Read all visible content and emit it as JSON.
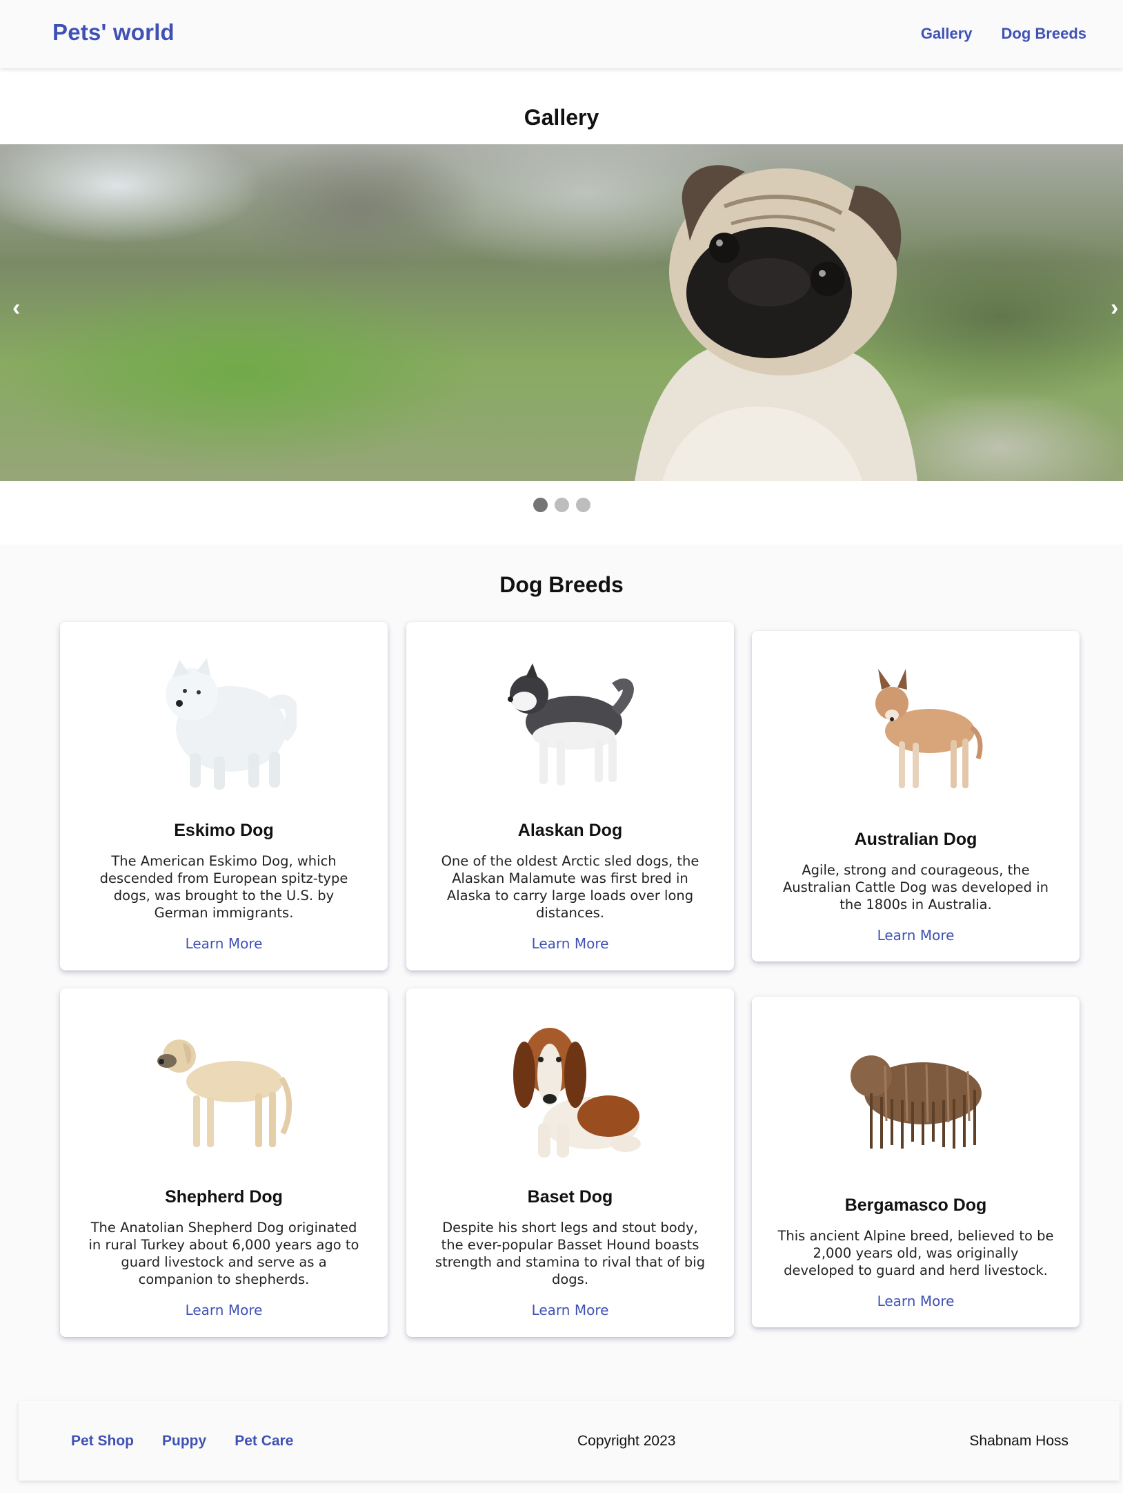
{
  "header": {
    "brand": "Pets' world",
    "nav": [
      "Gallery",
      "Dog Breeds"
    ]
  },
  "gallery": {
    "title": "Gallery",
    "prev_arrow": "‹",
    "next_arrow": "›",
    "slide_count": 3,
    "active_slide": 1
  },
  "breeds": {
    "title": "Dog Breeds",
    "cards": [
      {
        "name": "Eskimo Dog",
        "text": "The American Eskimo Dog, which descended from European spitz-type dogs, was brought to the U.S. by German immigrants.",
        "link": "Learn More"
      },
      {
        "name": "Alaskan Dog",
        "text": "One of the oldest Arctic sled dogs, the Alaskan Malamute was first bred in Alaska to carry large loads over long distances.",
        "link": "Learn More"
      },
      {
        "name": "Australian Dog",
        "text": "Agile, strong and courageous, the Australian Cattle Dog was developed in the 1800s in Australia.",
        "link": "Learn More"
      },
      {
        "name": "Shepherd Dog",
        "text": "The Anatolian Shepherd Dog originated in rural Turkey about 6,000 years ago to guard livestock and serve as a companion to shepherds.",
        "link": "Learn More"
      },
      {
        "name": "Baset Dog",
        "text": "Despite his short legs and stout body, the ever-popular Basset Hound boasts strength and stamina to rival that of big dogs.",
        "link": "Learn More"
      },
      {
        "name": "Bergamasco Dog",
        "text": "This ancient Alpine breed, believed to be 2,000 years old, was originally developed to guard and herd livestock.",
        "link": "Learn More"
      }
    ]
  },
  "footer": {
    "links": [
      "Pet Shop",
      "Puppy",
      "Pet Care"
    ],
    "copyright": "Copyright 2023",
    "author": "Shabnam Hoss"
  },
  "colors": {
    "accent": "#3f51b5",
    "dot_active": "#757575",
    "dot_inactive": "#bdbdbd"
  }
}
